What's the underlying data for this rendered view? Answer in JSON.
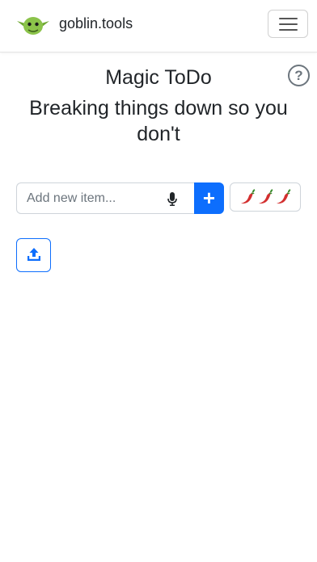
{
  "navbar": {
    "brand": "goblin.tools",
    "logo_icon": "goblin-head-icon",
    "menu_icon": "hamburger-menu-icon"
  },
  "main": {
    "title": "Magic ToDo",
    "help_icon": "question-circle-icon",
    "help_label": "?",
    "subtitle": "Breaking things down so you don't"
  },
  "todo_input": {
    "placeholder": "Add new item...",
    "value": "",
    "mic_icon": "microphone-icon",
    "add_label": "+",
    "add_icon": "plus-icon"
  },
  "spiciness": {
    "icon": "chili-pepper-icon",
    "level": 3
  },
  "upload": {
    "icon": "upload-icon"
  },
  "colors": {
    "accent": "#0d6efd",
    "goblin_green": "#8bc34a",
    "pepper_red": "#d32f2f"
  }
}
